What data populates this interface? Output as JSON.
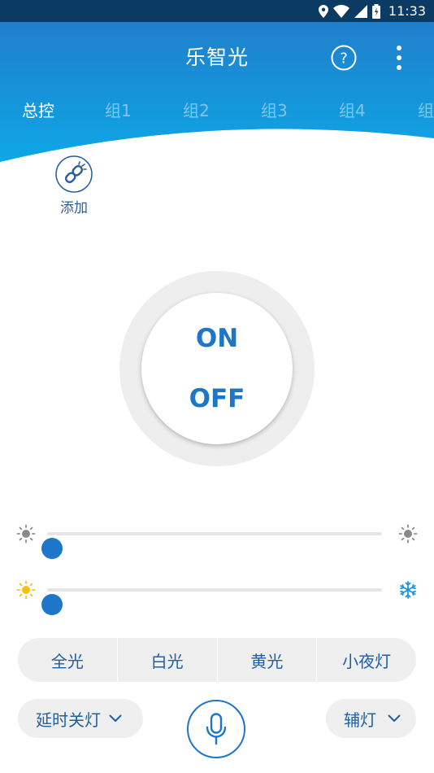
{
  "status_bar": {
    "time": "11:33"
  },
  "header": {
    "title": "乐智光",
    "tabs": [
      "总控",
      "组1",
      "组2",
      "组3",
      "组4",
      "组"
    ],
    "active_tab": 0
  },
  "add_group": {
    "label": "添加"
  },
  "power": {
    "on_label": "ON",
    "off_label": "OFF"
  },
  "sliders": {
    "brightness": {
      "value": 0.0
    },
    "color_temperature": {
      "value": 0.0
    }
  },
  "modes": [
    "全光",
    "白光",
    "黄光",
    "小夜灯"
  ],
  "bottom": {
    "timer_label": "延时关灯",
    "aux_label": "辅灯"
  },
  "colors": {
    "accent": "#1e76c8",
    "header_blue": "#1296dc",
    "status_bar": "#0b3a63"
  }
}
